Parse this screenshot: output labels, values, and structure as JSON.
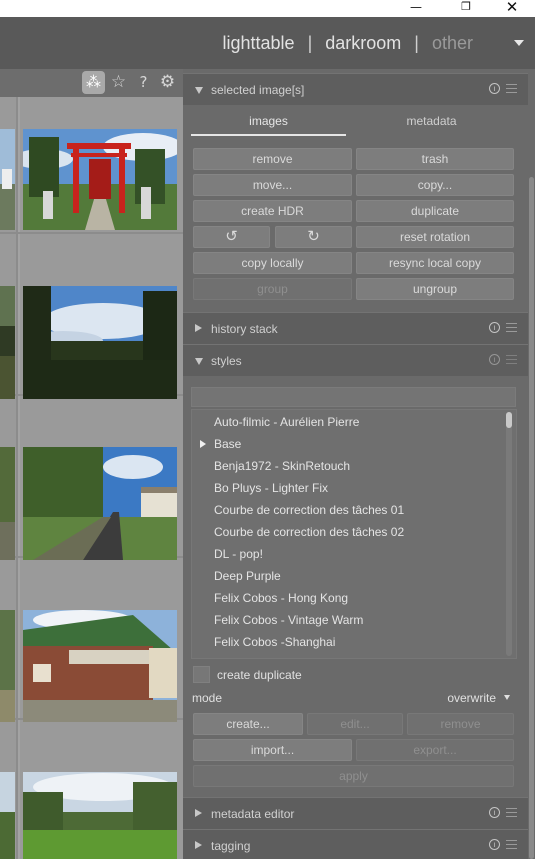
{
  "window": {
    "minimize_icon": "minimize-icon",
    "maximize_icon": "restore-icon",
    "close_icon": "close-icon"
  },
  "header": {
    "views": [
      "lighttable",
      "darkroom",
      "other"
    ],
    "separator": "|",
    "dropdown_icon": "caret-down-icon"
  },
  "center_toolbar": {
    "icons": [
      "grouping-icon",
      "star-icon",
      "help-icon",
      "gear-icon"
    ],
    "help_glyph": "?"
  },
  "selected_images": {
    "title": "selected image[s]",
    "tabs": [
      "images",
      "metadata"
    ],
    "active_tab": "images",
    "buttons": {
      "remove": "remove",
      "trash": "trash",
      "move": "move...",
      "copy": "copy...",
      "create_hdr": "create HDR",
      "duplicate": "duplicate",
      "reset_rotation": "reset rotation",
      "copy_locally": "copy locally",
      "resync_local_copy": "resync local copy",
      "group": "group",
      "ungroup": "ungroup"
    },
    "rotate_icons": [
      "rotate-ccw-icon",
      "rotate-cw-icon"
    ]
  },
  "history_stack": {
    "title": "history stack"
  },
  "styles": {
    "title": "styles",
    "search_value": "",
    "items": [
      "Auto-filmic - Aurélien Pierre",
      "Base",
      "Benja1972 - SkinRetouch",
      "Bo Pluys - Lighter Fix",
      "Courbe de correction des tâches 01",
      "Courbe de correction des tâches 02",
      "DL - pop!",
      "Deep Purple",
      "Felix Cobos - Hong Kong",
      "Felix Cobos - Vintage Warm",
      "Felix Cobos -Shanghai"
    ],
    "expandable_item": "Base",
    "create_duplicate_label": "create duplicate",
    "mode_label": "mode",
    "mode_value": "overwrite",
    "buttons": {
      "create": "create...",
      "edit": "edit...",
      "remove": "remove",
      "import": "import...",
      "export": "export...",
      "apply": "apply"
    }
  },
  "metadata_editor": {
    "title": "metadata editor"
  },
  "tagging": {
    "title": "tagging"
  },
  "colors": {
    "panel": "#6a6a6a",
    "header": "#595959",
    "lighttable_bg": "#9a9a9a"
  }
}
